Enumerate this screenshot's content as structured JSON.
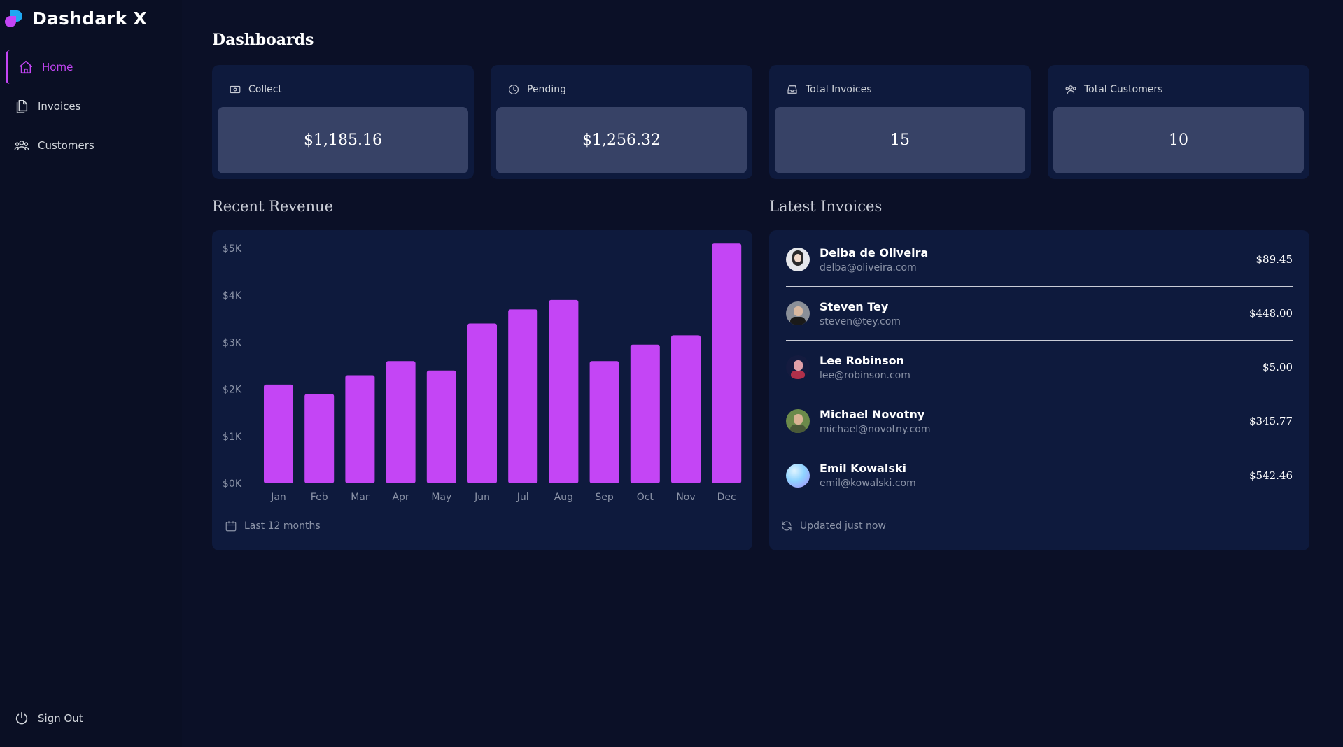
{
  "app": {
    "name": "Dashdark X",
    "logo_icon": "dashdark-logo-icon"
  },
  "sidebar": {
    "items": [
      {
        "label": "Home",
        "icon": "home-icon",
        "active": true
      },
      {
        "label": "Invoices",
        "icon": "document-icon",
        "active": false
      },
      {
        "label": "Customers",
        "icon": "users-icon",
        "active": false
      }
    ],
    "signout_label": "Sign Out"
  },
  "page": {
    "title": "Dashboards"
  },
  "cards": [
    {
      "label": "Collect",
      "value": "$1,185.16",
      "icon": "banknote-icon"
    },
    {
      "label": "Pending",
      "value": "$1,256.32",
      "icon": "clock-icon"
    },
    {
      "label": "Total Invoices",
      "value": "15",
      "icon": "inbox-icon"
    },
    {
      "label": "Total Customers",
      "value": "10",
      "icon": "users-icon"
    }
  ],
  "revenue": {
    "title": "Recent Revenue",
    "footer": "Last 12 months"
  },
  "chart_data": {
    "type": "bar",
    "categories": [
      "Jan",
      "Feb",
      "Mar",
      "Apr",
      "May",
      "Jun",
      "Jul",
      "Aug",
      "Sep",
      "Oct",
      "Nov",
      "Dec"
    ],
    "values": [
      2100,
      1900,
      2300,
      2600,
      2400,
      3400,
      3700,
      3900,
      2600,
      2950,
      3150,
      5100
    ],
    "yticks": [
      "$0K",
      "$1K",
      "$2K",
      "$3K",
      "$4K",
      "$5K"
    ],
    "ylim": [
      0,
      5000
    ],
    "title": "",
    "xlabel": "",
    "ylabel": "",
    "bar_color": "#c445f5"
  },
  "invoices": {
    "title": "Latest Invoices",
    "items": [
      {
        "name": "Delba de Oliveira",
        "email": "delba@oliveira.com",
        "amount": "$89.45"
      },
      {
        "name": "Steven Tey",
        "email": "steven@tey.com",
        "amount": "$448.00"
      },
      {
        "name": "Lee Robinson",
        "email": "lee@robinson.com",
        "amount": "$5.00"
      },
      {
        "name": "Michael Novotny",
        "email": "michael@novotny.com",
        "amount": "$345.77"
      },
      {
        "name": "Emil Kowalski",
        "email": "emil@kowalski.com",
        "amount": "$542.46"
      }
    ],
    "footer": "Updated just now"
  },
  "colors": {
    "background": "#0b1027",
    "panel": "#0e1a3d",
    "card_value_bg": "#374266",
    "accent": "#c445f5"
  }
}
